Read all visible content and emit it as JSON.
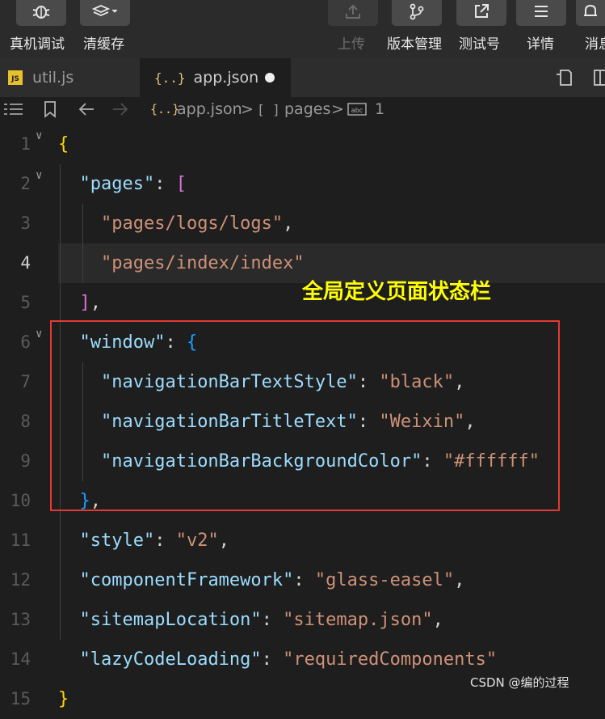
{
  "toolbar": {
    "left": [
      {
        "label": "真机调试",
        "icon": "bug-icon"
      },
      {
        "label": "清缓存",
        "icon": "layers-icon"
      }
    ],
    "right": [
      {
        "label": "上传",
        "icon": "upload-icon",
        "disabled": true
      },
      {
        "label": "版本管理",
        "icon": "branch-icon"
      },
      {
        "label": "测试号",
        "icon": "external-link-icon"
      },
      {
        "label": "详情",
        "icon": "menu-icon"
      },
      {
        "label": "消息",
        "icon": "bell-icon"
      }
    ]
  },
  "tabs": [
    {
      "label": "util.js",
      "icon": "js-file-icon",
      "active": false
    },
    {
      "label": "app.json",
      "icon": "json-file-icon",
      "active": true,
      "modified": true
    }
  ],
  "breadcrumb": {
    "file": "app.json",
    "path1": "pages",
    "path2": "1",
    "separator": ">"
  },
  "editor": {
    "active_line": 4,
    "lines": [
      {
        "n": "1",
        "tokens": [
          {
            "t": "{",
            "c": "br1"
          }
        ]
      },
      {
        "n": "2",
        "tokens": [
          {
            "t": "  ",
            "c": "p"
          },
          {
            "t": "\"pages\"",
            "c": "k"
          },
          {
            "t": ": ",
            "c": "p"
          },
          {
            "t": "[",
            "c": "br2"
          }
        ]
      },
      {
        "n": "3",
        "tokens": [
          {
            "t": "    ",
            "c": "p"
          },
          {
            "t": "\"pages/logs/logs\"",
            "c": "s"
          },
          {
            "t": ",",
            "c": "p"
          }
        ]
      },
      {
        "n": "4",
        "tokens": [
          {
            "t": "    ",
            "c": "p"
          },
          {
            "t": "\"pages/index/index\"",
            "c": "s"
          }
        ]
      },
      {
        "n": "5",
        "tokens": [
          {
            "t": "  ",
            "c": "p"
          },
          {
            "t": "]",
            "c": "br2"
          },
          {
            "t": ",",
            "c": "p"
          }
        ]
      },
      {
        "n": "6",
        "tokens": [
          {
            "t": "  ",
            "c": "p"
          },
          {
            "t": "\"window\"",
            "c": "k"
          },
          {
            "t": ": ",
            "c": "p"
          },
          {
            "t": "{",
            "c": "br3"
          }
        ]
      },
      {
        "n": "7",
        "tokens": [
          {
            "t": "    ",
            "c": "p"
          },
          {
            "t": "\"navigationBarTextStyle\"",
            "c": "k"
          },
          {
            "t": ": ",
            "c": "p"
          },
          {
            "t": "\"black\"",
            "c": "s"
          },
          {
            "t": ",",
            "c": "p"
          }
        ]
      },
      {
        "n": "8",
        "tokens": [
          {
            "t": "    ",
            "c": "p"
          },
          {
            "t": "\"navigationBarTitleText\"",
            "c": "k"
          },
          {
            "t": ": ",
            "c": "p"
          },
          {
            "t": "\"Weixin\"",
            "c": "s"
          },
          {
            "t": ",",
            "c": "p"
          }
        ]
      },
      {
        "n": "9",
        "tokens": [
          {
            "t": "    ",
            "c": "p"
          },
          {
            "t": "\"navigationBarBackgroundColor\"",
            "c": "k"
          },
          {
            "t": ": ",
            "c": "p"
          },
          {
            "t": "\"#ffffff\"",
            "c": "s"
          }
        ]
      },
      {
        "n": "10",
        "tokens": [
          {
            "t": "  ",
            "c": "p"
          },
          {
            "t": "}",
            "c": "br3"
          },
          {
            "t": ",",
            "c": "p"
          }
        ]
      },
      {
        "n": "11",
        "tokens": [
          {
            "t": "  ",
            "c": "p"
          },
          {
            "t": "\"style\"",
            "c": "k"
          },
          {
            "t": ": ",
            "c": "p"
          },
          {
            "t": "\"v2\"",
            "c": "s"
          },
          {
            "t": ",",
            "c": "p"
          }
        ]
      },
      {
        "n": "12",
        "tokens": [
          {
            "t": "  ",
            "c": "p"
          },
          {
            "t": "\"componentFramework\"",
            "c": "k"
          },
          {
            "t": ": ",
            "c": "p"
          },
          {
            "t": "\"glass-easel\"",
            "c": "s"
          },
          {
            "t": ",",
            "c": "p"
          }
        ]
      },
      {
        "n": "13",
        "tokens": [
          {
            "t": "  ",
            "c": "p"
          },
          {
            "t": "\"sitemapLocation\"",
            "c": "k"
          },
          {
            "t": ": ",
            "c": "p"
          },
          {
            "t": "\"sitemap.json\"",
            "c": "s"
          },
          {
            "t": ",",
            "c": "p"
          }
        ]
      },
      {
        "n": "14",
        "tokens": [
          {
            "t": "  ",
            "c": "p"
          },
          {
            "t": "\"lazyCodeLoading\"",
            "c": "k"
          },
          {
            "t": ": ",
            "c": "p"
          },
          {
            "t": "\"requiredComponents\"",
            "c": "s"
          }
        ]
      },
      {
        "n": "15",
        "tokens": [
          {
            "t": "}",
            "c": "br1"
          }
        ]
      }
    ]
  },
  "annotation": "全局定义页面状态栏",
  "watermark": "CSDN @编的过程",
  "colors": {
    "annotation": "#ffff00",
    "highlight_box": "#e53935"
  }
}
